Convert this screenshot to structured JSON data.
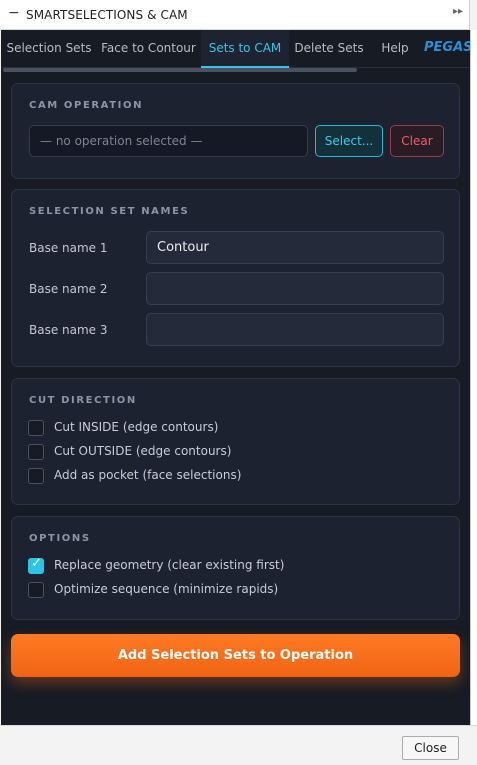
{
  "window": {
    "title": "SMARTSELECTIONS & CAM",
    "minimize_glyph": "−",
    "collapse_glyph": "▸▸"
  },
  "tabs": [
    {
      "label": "Selection Sets",
      "active": false
    },
    {
      "label": "Face to Contour",
      "active": false
    },
    {
      "label": "Sets to CAM",
      "active": true
    },
    {
      "label": "Delete Sets",
      "active": false
    },
    {
      "label": "Help",
      "active": false
    },
    {
      "label": "PEGAS",
      "active": false
    }
  ],
  "cam_operation": {
    "title": "CAM OPERATION",
    "field_value": "— no operation selected —",
    "select_label": "Select...",
    "clear_label": "Clear"
  },
  "selection_set_names": {
    "title": "SELECTION SET NAMES",
    "rows": [
      {
        "label": "Base name 1",
        "value": "Contour"
      },
      {
        "label": "Base name 2",
        "value": ""
      },
      {
        "label": "Base name 3",
        "value": ""
      }
    ]
  },
  "cut_direction": {
    "title": "CUT DIRECTION",
    "options": [
      {
        "label": "Cut INSIDE (edge contours)",
        "checked": false
      },
      {
        "label": "Cut OUTSIDE (edge contours)",
        "checked": false
      },
      {
        "label": "Add as pocket (face selections)",
        "checked": false
      }
    ]
  },
  "options": {
    "title": "OPTIONS",
    "items": [
      {
        "label": "Replace geometry (clear existing first)",
        "checked": true
      },
      {
        "label": "Optimize sequence (minimize rapids)",
        "checked": false
      }
    ]
  },
  "primary_button": "Add Selection Sets to Operation",
  "footer": {
    "close_label": "Close"
  },
  "colors": {
    "accent": "#2ec4e6",
    "danger": "#ef5d6b",
    "primary": "#f06414",
    "panel_bg": "#171b24"
  }
}
